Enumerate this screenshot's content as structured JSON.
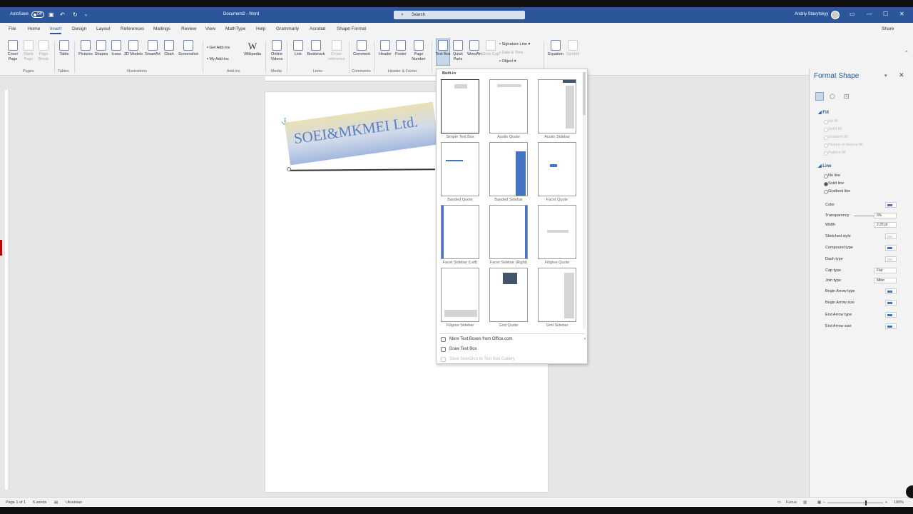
{
  "titlebar": {
    "autosave_label": "AutoSave",
    "autosave_state": "Off",
    "doc_title": "Document2 - Word",
    "search_placeholder": "Search",
    "user_name": "Andriy Stavytskyy",
    "window_buttons": [
      "minimize",
      "maximize",
      "close"
    ]
  },
  "tabs": [
    {
      "label": "File"
    },
    {
      "label": "Home"
    },
    {
      "label": "Insert"
    },
    {
      "label": "Design"
    },
    {
      "label": "Layout"
    },
    {
      "label": "References"
    },
    {
      "label": "Mailings"
    },
    {
      "label": "Review"
    },
    {
      "label": "View"
    },
    {
      "label": "MathType"
    },
    {
      "label": "Help"
    },
    {
      "label": "Grammarly"
    },
    {
      "label": "Acrobat"
    },
    {
      "label": "Shape Format"
    }
  ],
  "active_tab": "Insert",
  "share_label": "Share",
  "ribbon": {
    "cover_page": "Cover Page",
    "blank_page": "Blank Page",
    "page_break": "Page Break",
    "table": "Table",
    "pictures": "Pictures",
    "shapes": "Shapes",
    "icons": "Icons",
    "models3d": "3D Models",
    "smartart": "SmartArt",
    "chart": "Chart",
    "screenshot": "Screenshot",
    "get_addins": "Get Add-ins",
    "my_addins": "My Add-ins",
    "wikipedia": "Wikipedia",
    "online_videos": "Online Videos",
    "link": "Link",
    "bookmark": "Bookmark",
    "cross_reference": "Cross-reference",
    "comment": "Comment",
    "header": "Header",
    "footer": "Footer",
    "page_number": "Page Number",
    "text_box": "Text Box",
    "quick_parts": "Quick Parts",
    "wordart": "WordArt",
    "drop_cap": "Drop Cap",
    "signature_line": "Signature Line",
    "date_time": "Date & Time",
    "object": "Object",
    "equation": "Equation",
    "symbol": "Symbol",
    "groups": {
      "pages": "Pages",
      "tables": "Tables",
      "illustrations": "Illustrations",
      "addins": "Add-ins",
      "media": "Media",
      "links": "Links",
      "comments": "Comments",
      "header_footer": "Header & Footer"
    }
  },
  "document": {
    "wordart_text": "SOEI&MKMEI Ltd."
  },
  "gallery": {
    "header": "Built-in",
    "items": [
      {
        "label": "Simple Text Box"
      },
      {
        "label": "Austin Quote"
      },
      {
        "label": "Austin Sidebar"
      },
      {
        "label": "Banded Quote"
      },
      {
        "label": "Banded Sidebar"
      },
      {
        "label": "Facet Quote"
      },
      {
        "label": "Facet Sidebar (Left)"
      },
      {
        "label": "Facet Sidebar (Right)"
      },
      {
        "label": "Filigree Quote"
      },
      {
        "label": "Filigree Sidebar"
      },
      {
        "label": "Grid Quote"
      },
      {
        "label": "Grid Sidebar"
      }
    ],
    "more_label": "More Text Boxes from Office.com",
    "draw_label": "Draw Text Box",
    "save_label": "Save Selection to Text Box Gallery"
  },
  "format_pane": {
    "title": "Format Shape",
    "fill_section": "Fill",
    "fill_options": [
      "No fill",
      "Solid fill",
      "Gradient fill",
      "Picture or texture fill",
      "Pattern fill"
    ],
    "line_section": "Line",
    "line_options": [
      "No line",
      "Solid line",
      "Gradient line"
    ],
    "line_selected": "Solid line",
    "color_label": "Color",
    "transparency_label": "Transparency",
    "transparency_value": "0%",
    "width_label": "Width",
    "width_value": "2.25 pt",
    "sketched_label": "Sketched style",
    "compound_label": "Compound type",
    "dash_label": "Dash type",
    "cap_label": "Cap type",
    "cap_value": "Flat",
    "join_label": "Join type",
    "join_value": "Miter",
    "begin_arrow_type": "Begin Arrow type",
    "begin_arrow_size": "Begin Arrow size",
    "end_arrow_type": "End Arrow type",
    "end_arrow_size": "End Arrow size"
  },
  "statusbar": {
    "page": "Page 1 of 1",
    "words": "6 words",
    "language": "Ukrainian",
    "focus": "Focus",
    "zoom": "100%"
  }
}
